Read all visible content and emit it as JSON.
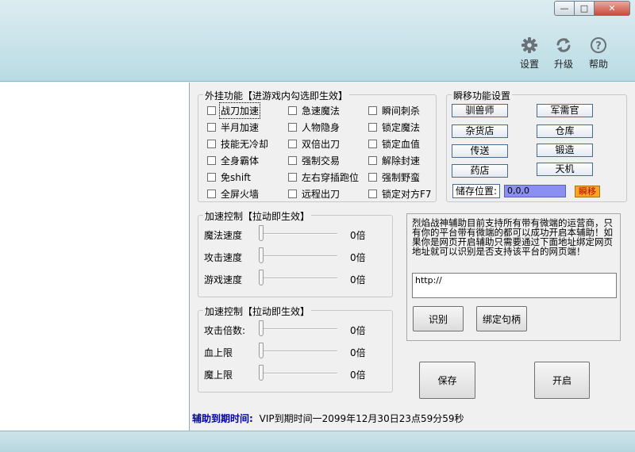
{
  "window": {
    "minimize_glyph": "—",
    "maximize_glyph": "□",
    "close_glyph": "✕"
  },
  "header": {
    "buttons": [
      {
        "label": "设置",
        "icon": "gear-icon"
      },
      {
        "label": "升级",
        "icon": "refresh-icon"
      },
      {
        "label": "帮助",
        "icon": "help-icon"
      }
    ]
  },
  "features": {
    "title": "外挂功能【进游戏内勾选即生效】",
    "items": [
      {
        "label": "战刀加速",
        "checked": false,
        "focused": true
      },
      {
        "label": "急速魔法",
        "checked": false
      },
      {
        "label": "瞬间刺杀",
        "checked": false
      },
      {
        "label": "半月加速",
        "checked": false
      },
      {
        "label": "人物隐身",
        "checked": false
      },
      {
        "label": "锁定魔法",
        "checked": false
      },
      {
        "label": "技能无冷却",
        "checked": false
      },
      {
        "label": "双倍出刀",
        "checked": false
      },
      {
        "label": "锁定血值",
        "checked": false
      },
      {
        "label": "全身霸体",
        "checked": false
      },
      {
        "label": "强制交易",
        "checked": false
      },
      {
        "label": "解除封速",
        "checked": false
      },
      {
        "label": "免shift",
        "checked": false
      },
      {
        "label": "左右穿插跑位",
        "checked": false
      },
      {
        "label": "强制野蛮",
        "checked": false
      },
      {
        "label": "全屏火墙",
        "checked": false
      },
      {
        "label": "远程出刀",
        "checked": false
      },
      {
        "label": "锁定对方F7",
        "checked": false
      }
    ]
  },
  "teleport": {
    "title": "瞬移功能设置",
    "buttons": [
      "驯兽师",
      "军需官",
      "杂货店",
      "仓库",
      "传送",
      "锻造",
      "药店",
      "天机"
    ],
    "save_label": "储存位置:",
    "coords": "0,0,0",
    "jump_label": "瞬移"
  },
  "speed": {
    "title": "加速控制【拉动即生效】",
    "rows": [
      {
        "label": "魔法速度",
        "value": "0倍"
      },
      {
        "label": "攻击速度",
        "value": "0倍"
      },
      {
        "label": "游戏速度",
        "value": "0倍"
      }
    ]
  },
  "stats": {
    "title": "加速控制【拉动即生效】",
    "rows": [
      {
        "label": "攻击倍数:",
        "value": "0倍"
      },
      {
        "label": "血上限",
        "value": "0倍"
      },
      {
        "label": "魔上限",
        "value": "0倍"
      }
    ]
  },
  "info": {
    "text": "烈焰战神辅助目前支持所有带有微端的运营商，只有你的平台带有微端的都可以成功开启本辅助！如果你是网页开启辅助只需要通过下面地址绑定网页地址就可以识别是否支持该平台的网页端！",
    "url_value": "http://",
    "identify_label": "识别",
    "bind_label": "绑定句柄"
  },
  "actions": {
    "save_label": "保存",
    "start_label": "开启"
  },
  "expiry": {
    "label": "辅助到期时间:",
    "value": "VIP到期时间一2099年12月30日23点59分59秒"
  },
  "colors": {
    "header_bg": "#c9e3ea",
    "coords_bg": "#8a8ff0",
    "jump_bg": "#f5a623",
    "label_blue": "#0000a8"
  }
}
